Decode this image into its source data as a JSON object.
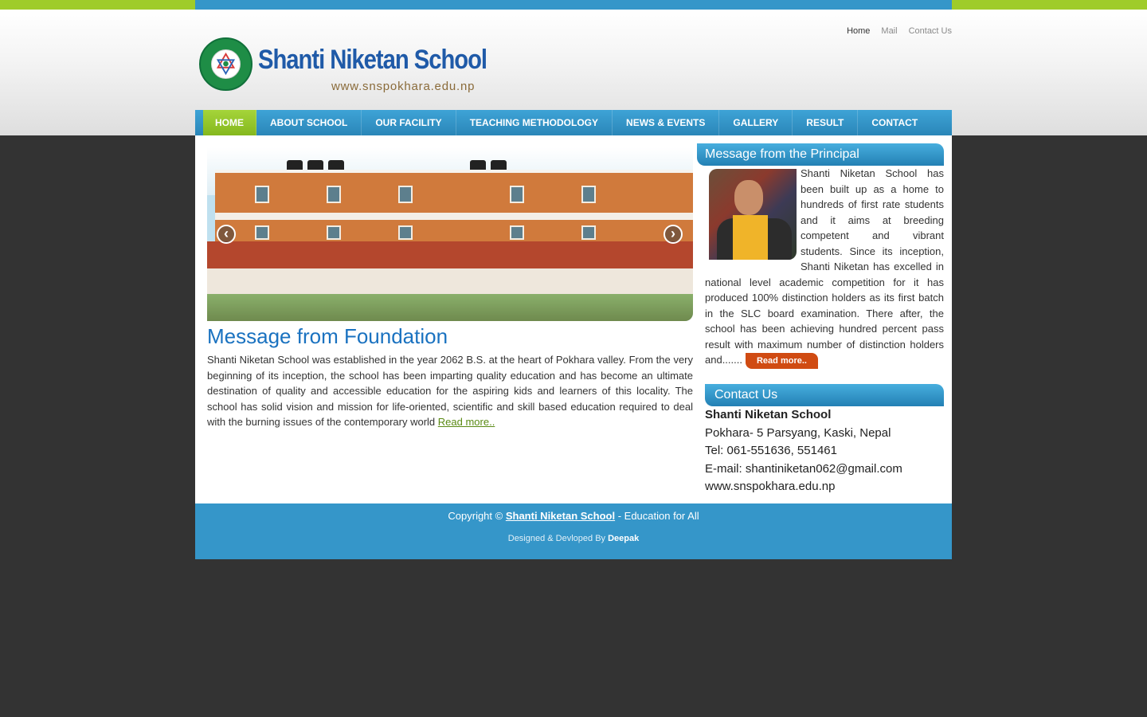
{
  "top_links": [
    {
      "label": "Home",
      "active": true
    },
    {
      "label": "Mail",
      "active": false
    },
    {
      "label": "Contact Us",
      "active": false
    }
  ],
  "logo": {
    "title": "Shanti Niketan School",
    "url": "www.snspokhara.edu.np",
    "emblem_ring_text": "SHANTI NIKETAN SCHOOL · Mahepatan, Pokhara"
  },
  "nav": {
    "items": [
      {
        "label": "HOME",
        "active": true
      },
      {
        "label": "ABOUT SCHOOL",
        "active": false
      },
      {
        "label": "OUR FACILITY",
        "active": false
      },
      {
        "label": "TEACHING METHODOLOGY",
        "active": false
      },
      {
        "label": "NEWS & EVENTS",
        "active": false
      },
      {
        "label": "GALLERY",
        "active": false
      },
      {
        "label": "RESULT",
        "active": false
      },
      {
        "label": "CONTACT",
        "active": false
      }
    ]
  },
  "slider": {
    "prev_symbol": "‹",
    "next_symbol": "›"
  },
  "foundation": {
    "title": "Message from Foundation",
    "text": "Shanti Niketan School was established in the year 2062 B.S. at the heart of Pokhara valley. From the very beginning of its inception, the school has been imparting quality education and has become an ultimate destination of quality and accessible education for the aspiring kids and learners of this locality. The school has solid vision and mission for life-oriented, scientific and skill based education required to deal with the burning issues of the contemporary world",
    "read_more": "Read more.."
  },
  "principal": {
    "title": "Message from the Principal",
    "text": "Shanti Niketan School has been built up as a home to hundreds of first rate students and it aims at breeding competent and vibrant students. Since its inception, Shanti Niketan has excelled in national level academic competition for it has produced 100% distinction holders as its first batch in the SLC board examination. There after, the school has been achieving hundred percent pass result with maximum number of distinction holders and.......",
    "read_more": "Read more.."
  },
  "contact": {
    "title": "Contact Us",
    "org": "Shanti Niketan School",
    "address": "Pokhara- 5 Parsyang, Kaski, Nepal",
    "tel": "Tel: 061-551636, 551461",
    "email": "E-mail: shantiniketan062@gmail.com",
    "web": "www.snspokhara.edu.np"
  },
  "footer": {
    "copyright_prefix": "Copyright ©",
    "school_link": "Shanti Niketan School",
    "copyright_suffix": "- Education for All",
    "designed_prefix": "Designed & Devloped By",
    "designer": "Deepak"
  },
  "colors": {
    "accent_blue": "#3596c9",
    "accent_green": "#9fcc2a",
    "heading_blue": "#1a72c0",
    "button_orange": "#d04b12",
    "page_bg": "#333333"
  }
}
